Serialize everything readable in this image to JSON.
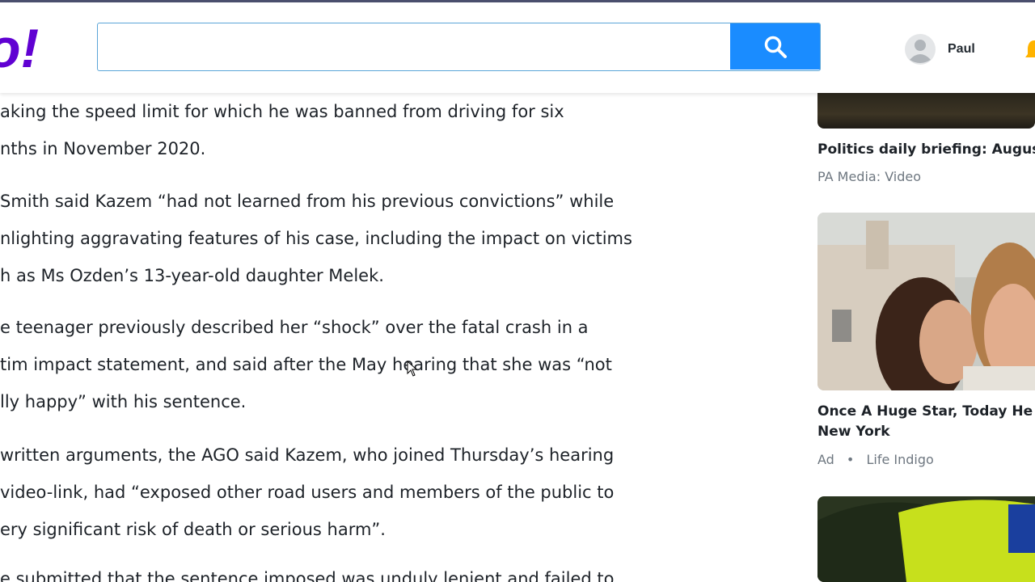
{
  "header": {
    "logo_text": "o!",
    "search": {
      "value": "",
      "placeholder": ""
    },
    "search_button_icon": "search-icon",
    "user": {
      "name": "Paul",
      "avatar_icon": "user-avatar-icon"
    },
    "notifications_icon": "bell-icon"
  },
  "article": {
    "paragraphs": [
      {
        "lines": [
          "aking the speed limit for which he was banned from driving for six",
          "nths in November 2020."
        ]
      },
      {
        "lines": [
          "Smith said Kazem “had not learned from his previous convictions” while",
          "nlighting aggravating features of his case, including the impact on victims",
          "h as Ms Ozden’s 13-year-old daughter Melek."
        ]
      },
      {
        "lines": [
          "e teenager previously described her “shock” over the fatal crash in a",
          "tim impact statement, and said after the May hearing that she was “not",
          "lly happy” with his sentence."
        ]
      },
      {
        "lines": [
          "written arguments, the AGO said Kazem, who joined Thursday’s hearing",
          "video-link, had “exposed other road users and members of the public to",
          "ery significant risk of death or serious harm”."
        ]
      },
      {
        "lines": [
          "e submitted that the sentence imposed was unduly lenient and failed to"
        ]
      }
    ]
  },
  "sidebar": {
    "cards": [
      {
        "title": "Politics daily briefing: August",
        "source": "PA Media: Video"
      },
      {
        "title_lines": [
          "Once A Huge Star, Today He Is",
          "New York"
        ],
        "ad_label": "Ad",
        "separator": "•",
        "source": "Life Indigo"
      }
    ]
  },
  "colors": {
    "accent": "#1a8cff",
    "brand_purple": "#6001d2",
    "top_line": "#4b4f6e"
  }
}
